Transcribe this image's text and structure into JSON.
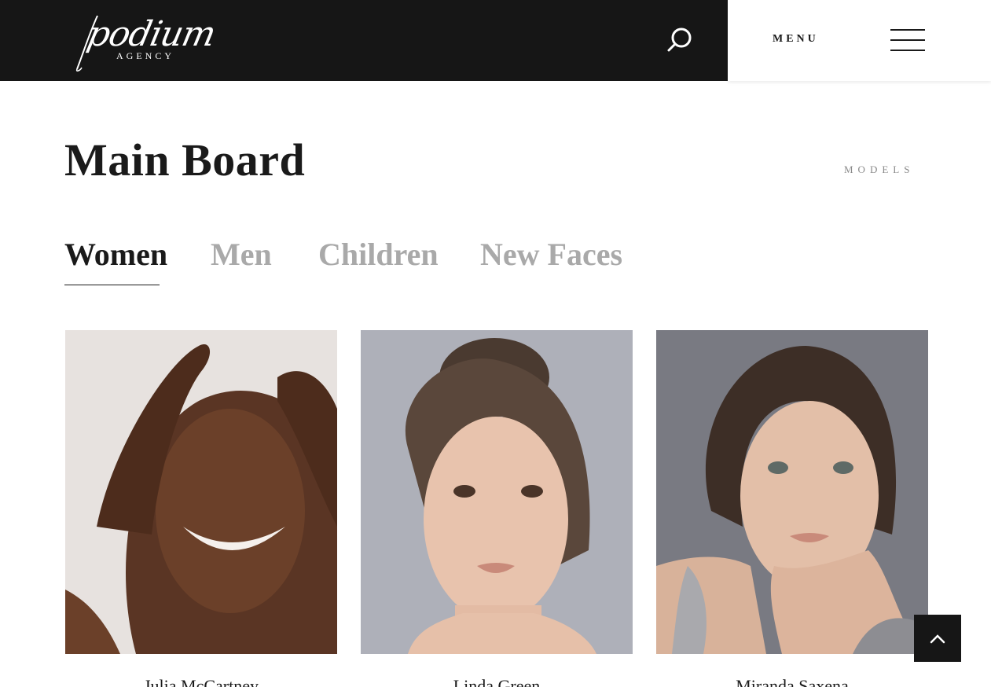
{
  "header": {
    "logo_script": "podium",
    "logo_sub": "AGENCY",
    "menu_label": "MENU"
  },
  "page": {
    "title": "Main Board",
    "breadcrumb": "MODELS"
  },
  "tabs": [
    {
      "label": "Women",
      "active": true
    },
    {
      "label": "Men",
      "active": false
    },
    {
      "label": "Children",
      "active": false
    },
    {
      "label": "New Faces",
      "active": false
    }
  ],
  "models": [
    {
      "name": "Julia McCartney",
      "skin": "#5a3524",
      "bg": "#ece9e6"
    },
    {
      "name": "Linda Green",
      "skin": "#e8c3ad",
      "bg": "#aeb0b9"
    },
    {
      "name": "Miranda Saxena",
      "skin": "#e3bfa8",
      "bg": "#6f7079"
    }
  ],
  "colors": {
    "header_dark": "#161616",
    "text": "#1a1a1a",
    "muted": "#a9a9a9"
  },
  "icons": {
    "search": "search-icon",
    "menu": "hamburger-menu-icon",
    "back_to_top": "chevron-up-icon"
  }
}
